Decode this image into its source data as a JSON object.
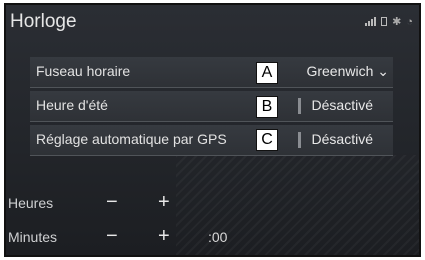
{
  "header": {
    "title": "Horloge",
    "status_icons": [
      "signal-icon",
      "battery-icon",
      "bluetooth-icon",
      "wifi-icon"
    ]
  },
  "settings": [
    {
      "label": "Fuseau horaire",
      "value": "Greenwich",
      "callout": "A",
      "has_dropdown": true
    },
    {
      "label": "Heure d'été",
      "value": "Désactivé",
      "callout": "B",
      "has_dropdown": false
    },
    {
      "label": "Réglage automatique par GPS",
      "value": "Désactivé",
      "callout": "C",
      "has_dropdown": false
    }
  ],
  "controls": {
    "hours_label": "Heures",
    "minutes_label": "Minutes",
    "minus": "−",
    "plus": "+",
    "minutes_reset": ":00"
  }
}
